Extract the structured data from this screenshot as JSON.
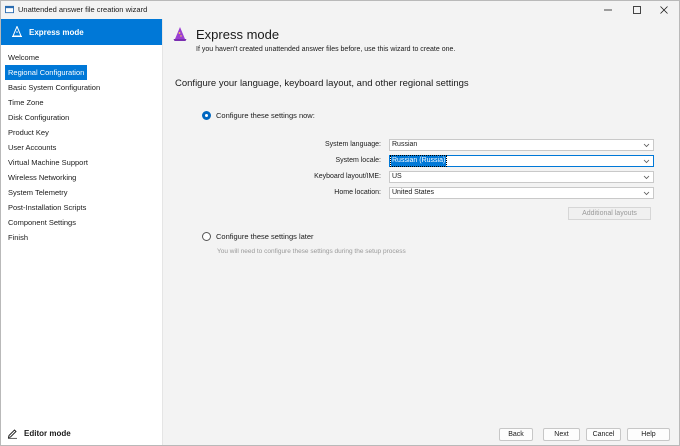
{
  "window": {
    "title": "Unattended answer file creation wizard"
  },
  "sidebar": {
    "header_label": "Express mode",
    "items": [
      {
        "label": "Welcome",
        "active": false
      },
      {
        "label": "Regional Configuration",
        "active": true
      },
      {
        "label": "Basic System Configuration",
        "active": false
      },
      {
        "label": "Time Zone",
        "active": false
      },
      {
        "label": "Disk Configuration",
        "active": false
      },
      {
        "label": "Product Key",
        "active": false
      },
      {
        "label": "User Accounts",
        "active": false
      },
      {
        "label": "Virtual Machine Support",
        "active": false
      },
      {
        "label": "Wireless Networking",
        "active": false
      },
      {
        "label": "System Telemetry",
        "active": false
      },
      {
        "label": "Post-Installation Scripts",
        "active": false
      },
      {
        "label": "Component Settings",
        "active": false
      },
      {
        "label": "Finish",
        "active": false
      }
    ],
    "footer_label": "Editor mode"
  },
  "main": {
    "title": "Express mode",
    "subtitle": "If you haven't created unattended answer files before, use this wizard to create one.",
    "section_title": "Configure your language, keyboard layout, and other regional settings",
    "option_now": "Configure these settings now:",
    "option_later": "Configure these settings later",
    "later_hint": "You will need to configure these settings during the setup process",
    "fields": {
      "system_language": {
        "label": "System language:",
        "value": "Russian"
      },
      "system_locale": {
        "label": "System locale:",
        "value": "Russian (Russia)"
      },
      "keyboard_layout": {
        "label": "Keyboard layout/IME:",
        "value": "US"
      },
      "home_location": {
        "label": "Home location:",
        "value": "United States"
      }
    },
    "additional_layouts": "Additional layouts"
  },
  "footer": {
    "back": "Back",
    "next": "Next",
    "cancel": "Cancel",
    "help": "Help"
  },
  "colors": {
    "accent": "#0078d7",
    "wizard_hat": "#9b3fd3"
  }
}
